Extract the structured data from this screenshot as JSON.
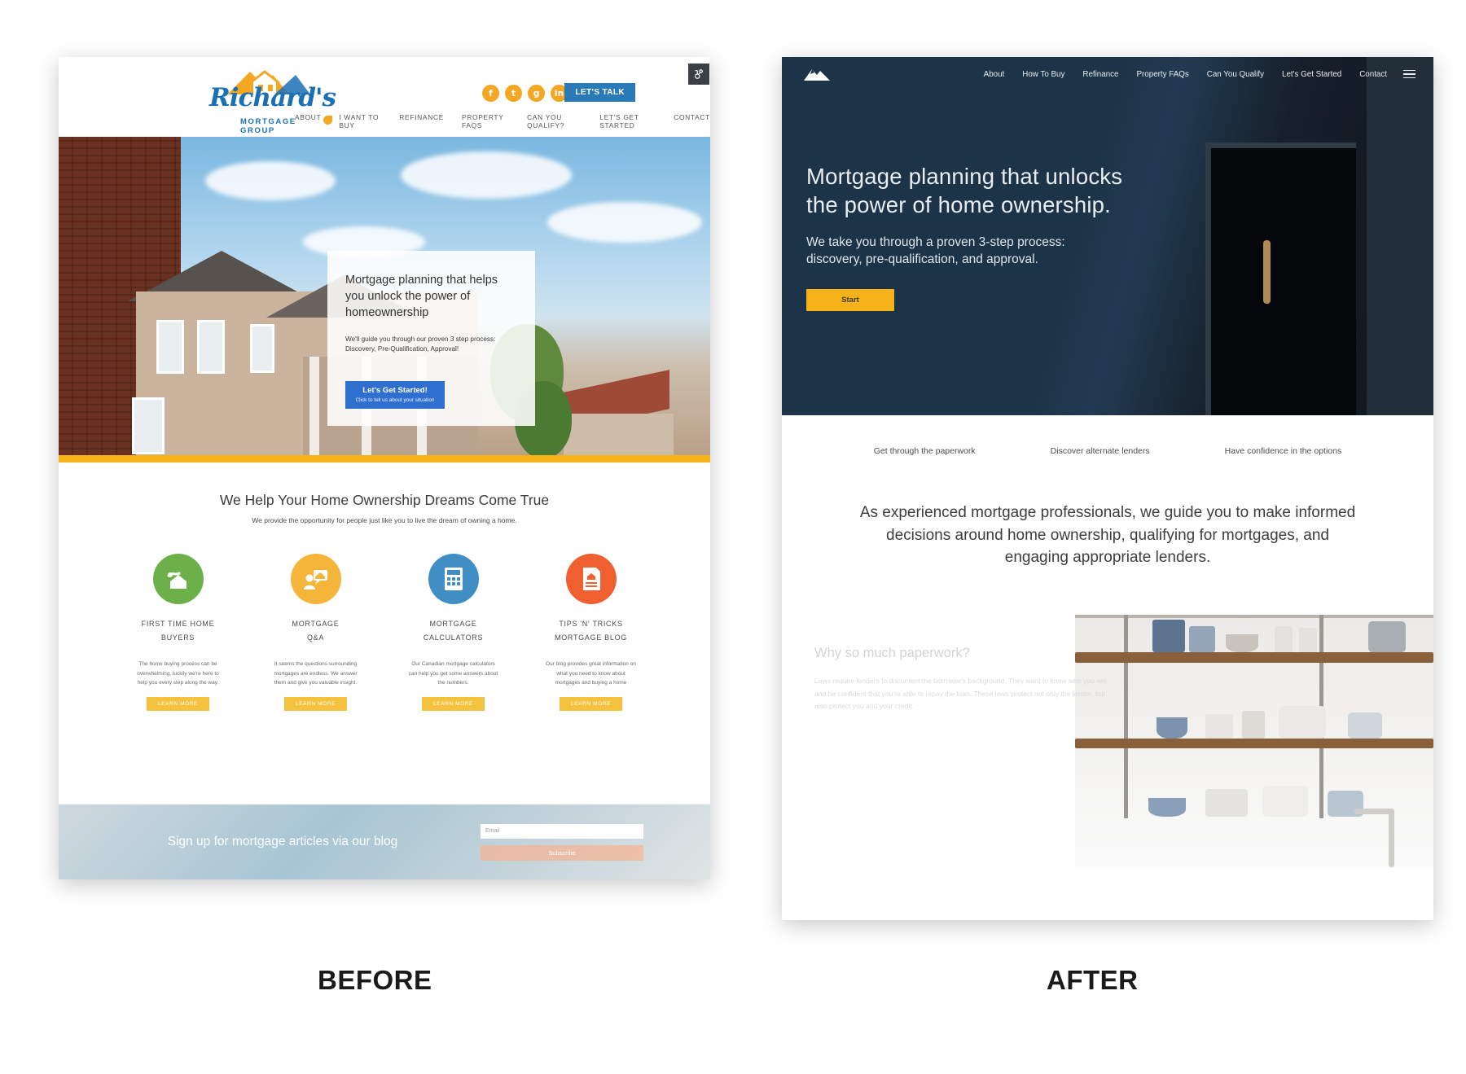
{
  "labels": {
    "before": "BEFORE",
    "after": "AFTER"
  },
  "colors": {
    "before_brand_blue": "#2a7ab8",
    "before_accent_yellow": "#f5b319",
    "after_navy": "#1d3347",
    "after_accent_yellow": "#f5b319",
    "icon_green": "#6cb04a",
    "icon_yellow": "#f5b53a",
    "icon_blue": "#3f8fc4",
    "icon_orange": "#ef5f30"
  },
  "before": {
    "logo": {
      "name": "Richard's",
      "subtitle": "MORTGAGE GROUP",
      "icon": "mountain-house-icon"
    },
    "social": [
      {
        "name": "facebook-icon",
        "glyph": "f"
      },
      {
        "name": "twitter-icon",
        "glyph": "t"
      },
      {
        "name": "google-plus-icon",
        "glyph": "g"
      },
      {
        "name": "linkedin-icon",
        "glyph": "in"
      }
    ],
    "cta_button": "LET'S TALK",
    "nav": [
      "ABOUT",
      "I WANT TO BUY",
      "REFINANCE",
      "PROPERTY FAQS",
      "CAN YOU QUALIFY?",
      "LET'S GET STARTED",
      "CONTACT"
    ],
    "hero": {
      "heading": "Mortgage planning that helps you unlock the power of homeownership",
      "subheading": "We'll guide you through our proven 3 step process: Discovery, Pre-Qualification, Approval!",
      "button_primary": "Let's Get Started!",
      "button_secondary": "Click to tell us about your situation"
    },
    "section": {
      "heading": "We Help Your Home Ownership Dreams Come True",
      "subheading": "We provide the opportunity for people just like you to live the dream of owning a home."
    },
    "cards": [
      {
        "icon": "hand-house-key-icon",
        "color": "#6cb04a",
        "title_line1": "FIRST TIME HOME",
        "title_line2": "BUYERS",
        "body": "The home buying process can be overwhelming, luckily we're here to help you every step along the way.",
        "button": "LEARN MORE"
      },
      {
        "icon": "agent-speech-house-icon",
        "color": "#f5b53a",
        "title_line1": "MORTGAGE",
        "title_line2": "Q&A",
        "body": "It seems the questions surrounding mortgages are endless.  We answer them and give you valuable insight.",
        "button": "LEARN MORE"
      },
      {
        "icon": "calculator-icon",
        "color": "#3f8fc4",
        "title_line1": "MORTGAGE",
        "title_line2": "CALCULATORS",
        "body": "Our Canadian mortgage calculators can help you get some answers about the numbers.",
        "button": "LEARN MORE"
      },
      {
        "icon": "document-house-icon",
        "color": "#ef5f30",
        "title_line1": "TIPS 'N' TRICKS",
        "title_line2": "MORTGAGE BLOG",
        "body": "Our blog provides great information on what you need to know about mortgages and buying a home",
        "button": "LEARN MORE"
      }
    ],
    "signup": {
      "heading": "Sign up for mortgage articles via our blog",
      "email_placeholder": "Email",
      "email_value": "",
      "subscribe_button": "Subscribe"
    }
  },
  "after": {
    "logo": {
      "icon": "mountain-logo-icon"
    },
    "nav": [
      "About",
      "How To Buy",
      "Refinance",
      "Property FAQs",
      "Can You Qualify",
      "Let's Get Started",
      "Contact"
    ],
    "menu_icon": "hamburger-menu-icon",
    "hero": {
      "heading_line1": "Mortgage planning that unlocks",
      "heading_line2": "the power of home ownership.",
      "subheading_line1": "We take you through a proven 3-step process:",
      "subheading_line2": "discovery, pre-qualification, and approval.",
      "button": "Start"
    },
    "bullets": [
      "Get through the paperwork",
      "Discover alternate lenders",
      "Have confidence in the options"
    ],
    "lead_paragraph": "As experienced mortgage professionals, we guide you to make informed decisions around home ownership, qualifying for mortgages, and engaging appropriate lenders.",
    "why": {
      "heading": "Why so much paperwork?",
      "body": "Laws require lenders to document the borrower's background. They want to know who you are and be confident that you're able to repay the loan. These laws protect not only the lender, but also protect you and your credit."
    }
  },
  "badge": {
    "icon": "hubspot-sprocket-icon"
  }
}
